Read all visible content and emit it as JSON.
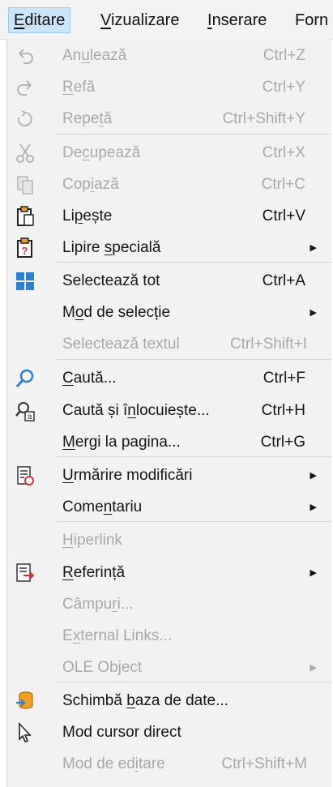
{
  "menubar": {
    "items": [
      {
        "label": "Editare",
        "mnemonic": "E"
      },
      {
        "label": "Vizualizare",
        "mnemonic": "V"
      },
      {
        "label": "Inserare",
        "mnemonic": "I"
      },
      {
        "label": "Forn",
        "mnemonic": ""
      }
    ]
  },
  "menu": {
    "items": [
      {
        "id": "undo",
        "label": "Anulează",
        "shortcut": "Ctrl+Z",
        "enabled": false,
        "submenu": false,
        "icon": "undo-icon",
        "u_index": 2
      },
      {
        "id": "redo",
        "label": "Refă",
        "shortcut": "Ctrl+Y",
        "enabled": false,
        "submenu": false,
        "icon": "redo-icon",
        "u_index": 0
      },
      {
        "id": "repeat",
        "label": "Repetă",
        "shortcut": "Ctrl+Shift+Y",
        "enabled": false,
        "submenu": false,
        "icon": "repeat-icon",
        "u_index": 4
      },
      {
        "id": "cut",
        "label": "Decupează",
        "shortcut": "Ctrl+X",
        "enabled": false,
        "submenu": false,
        "icon": "scissors-icon",
        "u_index": 2
      },
      {
        "id": "copy",
        "label": "Copiază",
        "shortcut": "Ctrl+C",
        "enabled": false,
        "submenu": false,
        "icon": "copy-icon",
        "u_index": 3
      },
      {
        "id": "paste",
        "label": "Lipește",
        "shortcut": "Ctrl+V",
        "enabled": true,
        "submenu": false,
        "icon": "paste-icon",
        "u_index": 2
      },
      {
        "id": "paste_special",
        "label": "Lipire specială",
        "shortcut": "",
        "enabled": true,
        "submenu": true,
        "icon": "paste-special-icon",
        "u_index": 7
      },
      {
        "id": "select_all",
        "label": "Selectează tot",
        "shortcut": "Ctrl+A",
        "enabled": true,
        "submenu": false,
        "icon": "select-all-icon",
        "u_index": -1
      },
      {
        "id": "selection_mode",
        "label": "Mod de selecție",
        "shortcut": "",
        "enabled": true,
        "submenu": true,
        "icon": "",
        "u_index": 1
      },
      {
        "id": "select_text",
        "label": "Selectează textul",
        "shortcut": "Ctrl+Shift+I",
        "enabled": false,
        "submenu": false,
        "icon": "",
        "u_index": -1
      },
      {
        "id": "find",
        "label": "Caută...",
        "shortcut": "Ctrl+F",
        "enabled": true,
        "submenu": false,
        "icon": "search-icon",
        "u_index": 0
      },
      {
        "id": "find_replace",
        "label": "Caută și înlocuiește...",
        "shortcut": "Ctrl+H",
        "enabled": true,
        "submenu": false,
        "icon": "find-replace-icon",
        "u_index": 10
      },
      {
        "id": "goto_page",
        "label": "Mergi la pagina...",
        "shortcut": "Ctrl+G",
        "enabled": true,
        "submenu": false,
        "icon": "",
        "u_index": 0
      },
      {
        "id": "track_changes",
        "label": "Urmărire modificări",
        "shortcut": "",
        "enabled": true,
        "submenu": true,
        "icon": "track-changes-icon",
        "u_index": 0
      },
      {
        "id": "comment",
        "label": "Comentariu",
        "shortcut": "",
        "enabled": true,
        "submenu": true,
        "icon": "",
        "u_index": 4
      },
      {
        "id": "hyperlink",
        "label": "Hiperlink",
        "shortcut": "",
        "enabled": false,
        "submenu": false,
        "icon": "",
        "u_index": 0
      },
      {
        "id": "reference",
        "label": "Referință",
        "shortcut": "",
        "enabled": true,
        "submenu": true,
        "icon": "reference-icon",
        "u_index": 0
      },
      {
        "id": "fields",
        "label": "Câmpuri...",
        "shortcut": "",
        "enabled": false,
        "submenu": false,
        "icon": "",
        "u_index": 5
      },
      {
        "id": "external_links",
        "label": "External Links...",
        "shortcut": "",
        "enabled": false,
        "submenu": false,
        "icon": "",
        "u_index": 1
      },
      {
        "id": "ole_object",
        "label": "OLE Object",
        "shortcut": "",
        "enabled": false,
        "submenu": true,
        "icon": "",
        "u_index": -1
      },
      {
        "id": "exchange_db",
        "label": "Schimbă baza de date...",
        "shortcut": "",
        "enabled": true,
        "submenu": false,
        "icon": "database-exchange-icon",
        "u_index": 8
      },
      {
        "id": "direct_cursor",
        "label": "Mod cursor direct",
        "shortcut": "",
        "enabled": true,
        "submenu": false,
        "icon": "cursor-icon",
        "u_index": -1
      },
      {
        "id": "edit_mode",
        "label": "Mod de editare",
        "shortcut": "Ctrl+Shift+M",
        "enabled": false,
        "submenu": false,
        "icon": "",
        "u_index": 9
      }
    ]
  },
  "submenu_arrow": "▶"
}
